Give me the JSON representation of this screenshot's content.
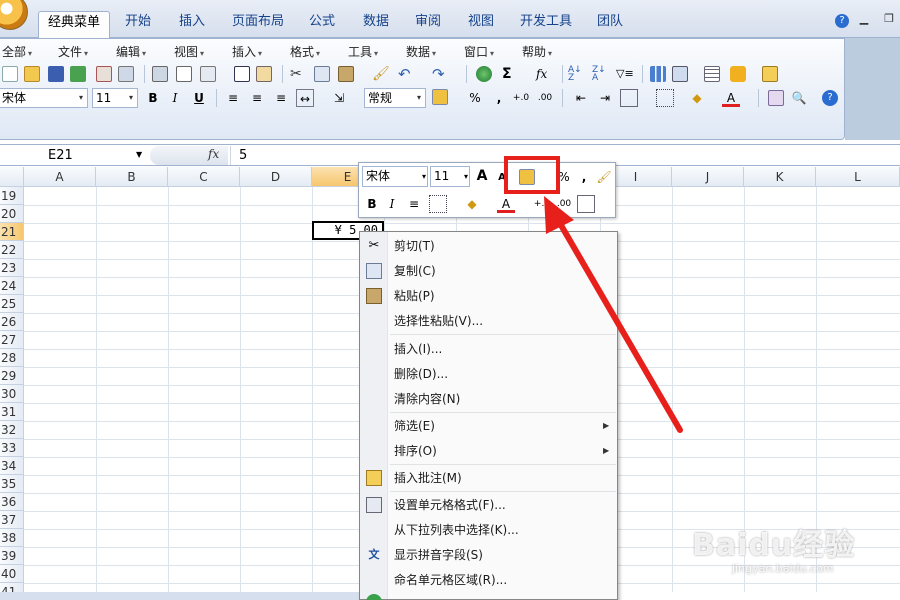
{
  "ribbon_tabs": [
    "经典菜单",
    "开始",
    "插入",
    "页面布局",
    "公式",
    "数据",
    "审阅",
    "视图",
    "开发工具",
    "团队"
  ],
  "classic_menu": [
    "全部",
    "文件",
    "编辑",
    "视图",
    "插入",
    "格式",
    "工具",
    "数据",
    "窗口",
    "帮助"
  ],
  "toolbar": {
    "font_name": "宋体",
    "font_size": "11",
    "number_format": "常规",
    "bold": "B",
    "italic": "I",
    "underline": "U",
    "percent": "%",
    "sigma": "Σ",
    "fx": "fx"
  },
  "formula_bar": {
    "name_box": "E21",
    "fx_label": "fx",
    "formula": "5"
  },
  "columns": [
    "A",
    "B",
    "C",
    "D",
    "E",
    "F",
    "G",
    "H",
    "I",
    "J",
    "K",
    "L"
  ],
  "rows": [
    "19",
    "20",
    "21",
    "22",
    "23",
    "24",
    "25",
    "26",
    "27",
    "28",
    "29",
    "30",
    "31",
    "32",
    "33",
    "34",
    "35",
    "36",
    "37",
    "38",
    "39",
    "40",
    "41"
  ],
  "active_cell": {
    "ref": "E21",
    "display": "¥ 5.00"
  },
  "mini_toolbar": {
    "font_name": "宋体",
    "font_size": "11",
    "grow_font": "A",
    "shrink_font": "A",
    "percent": "%",
    "comma": ",",
    "bold": "B",
    "italic": "I"
  },
  "context_menu": [
    {
      "label": "剪切(T)",
      "icon": "scissors-icon"
    },
    {
      "label": "复制(C)",
      "icon": "copy-icon"
    },
    {
      "label": "粘贴(P)",
      "icon": "paste-icon"
    },
    {
      "label": "选择性粘贴(V)...",
      "icon": ""
    },
    {
      "label": "插入(I)...",
      "icon": ""
    },
    {
      "label": "删除(D)...",
      "icon": ""
    },
    {
      "label": "清除内容(N)",
      "icon": ""
    },
    {
      "label": "筛选(E)",
      "icon": "",
      "submenu": true
    },
    {
      "label": "排序(O)",
      "icon": "",
      "submenu": true
    },
    {
      "label": "插入批注(M)",
      "icon": "comment-folder-icon"
    },
    {
      "label": "设置单元格格式(F)...",
      "icon": "format-cells-icon"
    },
    {
      "label": "从下拉列表中选择(K)...",
      "icon": ""
    },
    {
      "label": "显示拼音字段(S)",
      "icon": "phonetic-icon"
    },
    {
      "label": "命名单元格区域(R)...",
      "icon": ""
    }
  ],
  "watermark": {
    "logo": "Baidu经验",
    "url": "jingyan.baidu.com"
  },
  "colors": {
    "highlight": "#e8201c",
    "selected_header": "#f7c66e"
  }
}
